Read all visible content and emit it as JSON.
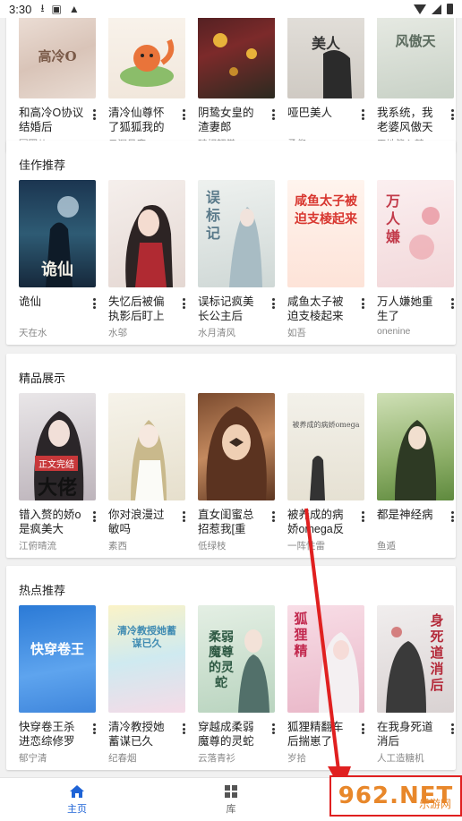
{
  "status_bar": {
    "time": "3:30"
  },
  "sections": [
    {
      "title": "",
      "books": [
        {
          "title": "和高冷O协议结婚后",
          "author": "圆圈儿",
          "cover_text": "高冷O"
        },
        {
          "title": "清冷仙尊怀了狐狐我的",
          "author": "云深见鹿",
          "cover_text": ""
        },
        {
          "title": "阴鸷女皇的渣妻郎",
          "author": "醉相韶裳",
          "cover_text": ""
        },
        {
          "title": "哑巴美人",
          "author": "柔倪",
          "cover_text": "美人"
        },
        {
          "title": "我系统，我老婆风傲天",
          "author": "天地皆入梦",
          "cover_text": "风傲天"
        }
      ]
    },
    {
      "title": "佳作推荐",
      "books": [
        {
          "title": "诡仙",
          "author": "天在水",
          "cover_text": "诡仙"
        },
        {
          "title": "失忆后被偏执影后盯上",
          "author": "水邬",
          "cover_text": ""
        },
        {
          "title": "误标记疯美长公主后",
          "author": "水月清风",
          "cover_text": "误标记"
        },
        {
          "title": "咸鱼太子被迫支棱起来",
          "author": "如吾",
          "cover_text": "咸鱼太子被迫支棱起来"
        },
        {
          "title": "万人嫌她重生了",
          "author": "onenine",
          "cover_text": "万人嫌"
        }
      ]
    },
    {
      "title": "精品展示",
      "books": [
        {
          "title": "错入赘的娇o是疯美大",
          "author": "江俯晴流",
          "cover_text": "大佬",
          "badge": "正文完结"
        },
        {
          "title": "你对浪漫过敏吗",
          "author": "素西",
          "cover_text": ""
        },
        {
          "title": "直女闺蜜总招惹我[重",
          "author": "低绿枝",
          "cover_text": ""
        },
        {
          "title": "被养成的病娇omega反",
          "author": "一阵性雷",
          "cover_text": "被养成的病娇omega"
        },
        {
          "title": "都是神经病",
          "author": "鱼遁",
          "cover_text": ""
        }
      ]
    },
    {
      "title": "热点推荐",
      "books": [
        {
          "title": "快穿卷王杀进恋综修罗",
          "author": "郁宁清",
          "cover_text": "快穿卷王"
        },
        {
          "title": "清冷教授她蓄谋已久",
          "author": "纪春烟",
          "cover_text": "清冷教授她蓄谋已久"
        },
        {
          "title": "穿越成柔弱魔尊的灵蛇",
          "author": "云落青衫",
          "cover_text": "柔弱魔尊的灵蛇"
        },
        {
          "title": "狐狸精翻车后揣崽了",
          "author": "岁拾",
          "cover_text": "狐狸精"
        },
        {
          "title": "在我身死道消后",
          "author": "人工造糖机",
          "cover_text": "身死道消后"
        }
      ]
    }
  ],
  "bottom_nav": {
    "home_label": "主页",
    "library_label": "库"
  },
  "watermark": {
    "text": "962.NET",
    "sub": "乐游网"
  },
  "colors": {
    "accent": "#1e63d6",
    "watermark_border": "#e02020",
    "arrow": "#e02020"
  }
}
